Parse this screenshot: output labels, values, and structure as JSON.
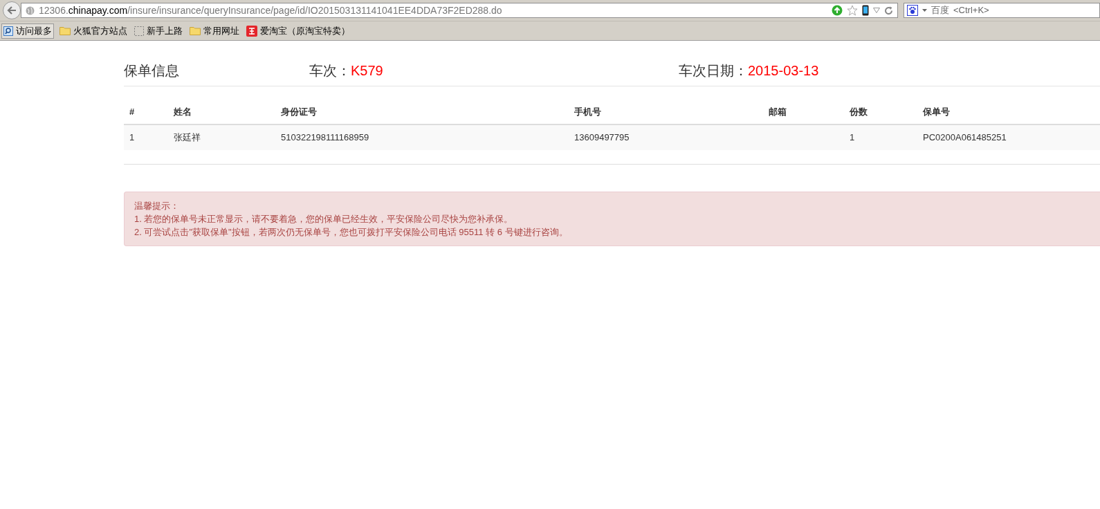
{
  "browser": {
    "url": "12306.**chinapay.com**/insure/insurance/queryInsurance/page/id/IO201503131141041EE4DDA73F2ED288.do",
    "search_engine": "百度",
    "search_placeholder": "<Ctrl+K>",
    "bookmarks": [
      {
        "label": "访问最多",
        "kind": "smart"
      },
      {
        "label": "火狐官方站点",
        "kind": "folder"
      },
      {
        "label": "新手上路",
        "kind": "page"
      },
      {
        "label": "常用网址",
        "kind": "folder"
      },
      {
        "label": "爱淘宝（原淘宝特卖）",
        "kind": "taobao"
      }
    ]
  },
  "header": {
    "title": "保单信息",
    "train_label": "车次：",
    "train": "K579",
    "date_label": "车次日期：",
    "date": "2015-03-13"
  },
  "table": {
    "columns": [
      "#",
      "姓名",
      "身份证号",
      "手机号",
      "邮箱",
      "份数",
      "保单号"
    ],
    "rows": [
      [
        "1",
        "张廷祥",
        "510322198111168959",
        "13609497795",
        "",
        "1",
        "PC0200A061485251"
      ]
    ]
  },
  "alert": {
    "title": "温馨提示：",
    "lines": [
      "1. 若您的保单号未正常显示，请不要着急，您的保单已经生效，平安保险公司尽快为您补承保。",
      "2. 可尝试点击\"获取保单\"按钮，若两次仍无保单号，您也可拨打平安保险公司电话 95511 转 6 号键进行咨询。"
    ]
  }
}
